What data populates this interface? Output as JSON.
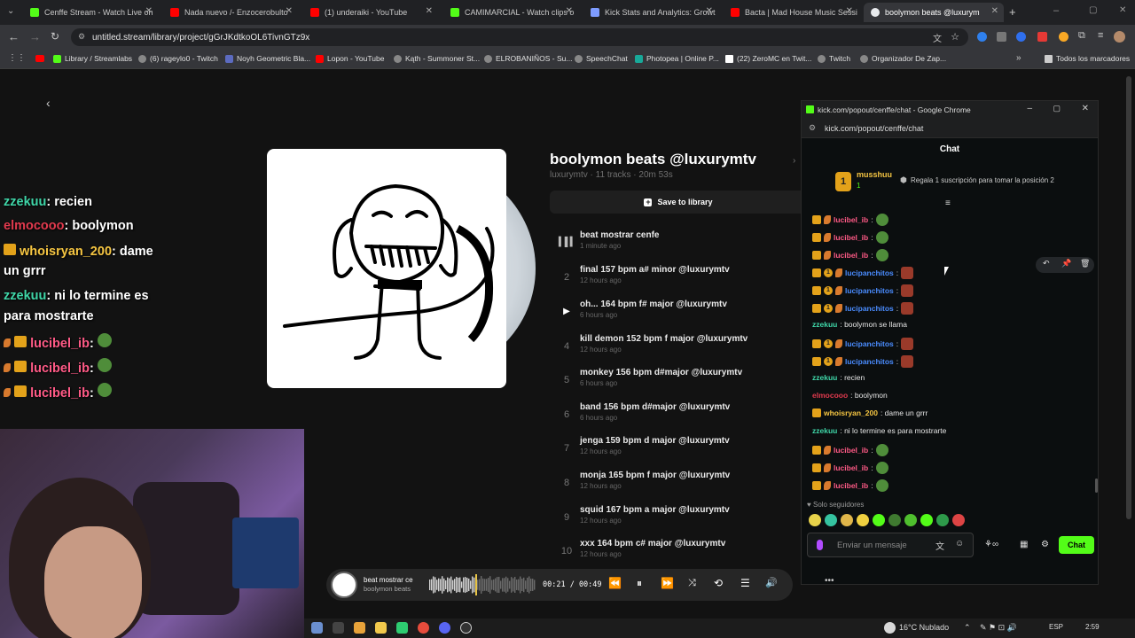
{
  "browser": {
    "tabs": [
      {
        "label": "Cenffe Stream - Watch Live on",
        "color": "#53fc18"
      },
      {
        "label": "Nada nuevo /- Enzocerobulto",
        "color": "#ff0000"
      },
      {
        "label": "(1) underaiki - YouTube",
        "color": "#ff0000"
      },
      {
        "label": "CAMIMARCIAL - Watch clips o",
        "color": "#53fc18"
      },
      {
        "label": "Kick Stats and Analytics: Growt",
        "color": "#7e9cff"
      },
      {
        "label": "Bacta | Mad House Music Sessi",
        "color": "#ff0000"
      },
      {
        "label": "boolymon beats @luxurym",
        "color": "#e8eaed"
      }
    ],
    "url": "untitled.stream/library/project/gGrJKdtkoOL6TivnGTz9x",
    "bookmarks": [
      "Library / Streamlabs",
      "(6) rageylo0 - Twitch",
      "Noyh Geometric Bla...",
      "Lopon - YouTube",
      "Kąth - Summoner St...",
      "ELROBANIÑOS - Su...",
      "SpeechChat",
      "Photopea | Online P...",
      "(22) ZeroMC en Twit...",
      "Twitch",
      "Organizador De Zap..."
    ],
    "bookmarks_all": "Todos los marcadores"
  },
  "project": {
    "title": "boolymon beats @luxurymtv",
    "meta": "luxurymtv · 11 tracks · 20m 53s",
    "save_label": "Save to library",
    "tracks": [
      {
        "num": "",
        "name": "beat mostrar cenfe",
        "date": "1 minute ago"
      },
      {
        "num": "2",
        "name": "final 157 bpm a# minor @luxurymtv",
        "date": "12 hours ago"
      },
      {
        "num": "",
        "name": "oh... 164 bpm f# major @luxurymtv",
        "date": "6 hours ago"
      },
      {
        "num": "4",
        "name": "kill demon 152 bpm f major @luxurymtv",
        "date": "12 hours ago"
      },
      {
        "num": "5",
        "name": "monkey 156 bpm d#major @luxurymtv",
        "date": "6 hours ago"
      },
      {
        "num": "6",
        "name": "band 156 bpm d#major @luxurymtv",
        "date": "6 hours ago"
      },
      {
        "num": "7",
        "name": "jenga 159 bpm d major @luxurymtv",
        "date": "12 hours ago"
      },
      {
        "num": "8",
        "name": "monja 165 bpm f major @luxurymtv",
        "date": "12 hours ago"
      },
      {
        "num": "9",
        "name": "squid 167 bpm a major @luxurymtv",
        "date": "12 hours ago"
      },
      {
        "num": "10",
        "name": "xxx 164 bpm c# major @luxurymtv",
        "date": "12 hours ago"
      }
    ]
  },
  "overlay_chat": {
    "m1_user": "zzekuu",
    "m1_text": ": recien",
    "m2_user": "elmocooo",
    "m2_text": ": boolymon",
    "m3_user": "whoisryan_200",
    "m3_text": ": dame",
    "m3_cont": "un grrr",
    "m4_user": "zzekuu",
    "m4_text": ": ni lo termine es",
    "m4_cont": "para mostrarte",
    "m5_user": "lucibel_ib",
    "m5_text": ":"
  },
  "player": {
    "track": "beat mostrar ce",
    "artist": "boolymon beats",
    "time": "00:21 / 00:49",
    "progress": 0.43
  },
  "kick": {
    "window_title": "kick.com/popout/cenffe/chat - Google Chrome",
    "url": "kick.com/popout/cenffe/chat",
    "header": "Chat",
    "top_user": "musshuu",
    "top_count": "1",
    "gift_text": "Regala 1 suscripción para tomar la posición 2",
    "messages": [
      {
        "user": "lucibel_ib",
        "text": ":",
        "color": "u-pink",
        "badges": "crown,pepper"
      },
      {
        "user": "lucibel_ib",
        "text": ":",
        "color": "u-pink",
        "badges": "crown,pepper"
      },
      {
        "user": "lucibel_ib",
        "text": ":",
        "color": "u-pink",
        "badges": "crown,pepper"
      },
      {
        "user": "lucipanchitos",
        "text": ":",
        "color": "u-blue",
        "badges": "crown,one,pepper"
      },
      {
        "user": "lucipanchitos",
        "text": ":",
        "color": "u-blue",
        "badges": "crown,one,pepper"
      },
      {
        "user": "lucipanchitos",
        "text": ":",
        "color": "u-blue",
        "badges": "crown,one,pepper"
      },
      {
        "user": "zzekuu",
        "text": ": boolymon se llama",
        "color": "u-teal",
        "badges": ""
      },
      {
        "user": "lucipanchitos",
        "text": ":",
        "color": "u-blue",
        "badges": "crown,one,pepper"
      },
      {
        "user": "lucipanchitos",
        "text": ":",
        "color": "u-blue",
        "badges": "crown,one,pepper"
      },
      {
        "user": "zzekuu",
        "text": ": recien",
        "color": "u-teal",
        "badges": ""
      },
      {
        "user": "elmocooo",
        "text": ": boolymon",
        "color": "u-red",
        "badges": ""
      },
      {
        "user": "whoisryan_200",
        "text": ": dame un grrr",
        "color": "u-gold",
        "badges": "crown"
      },
      {
        "user": "zzekuu",
        "text": ": ni lo termine es para mostrarte",
        "color": "u-teal",
        "badges": ""
      },
      {
        "user": "lucibel_ib",
        "text": ":",
        "color": "u-pink",
        "badges": "crown,pepper"
      },
      {
        "user": "lucibel_ib",
        "text": ":",
        "color": "u-pink",
        "badges": "crown,pepper"
      },
      {
        "user": "lucibel_ib",
        "text": ":",
        "color": "u-pink",
        "badges": "crown,pepper"
      }
    ],
    "followers_only": "Solo seguidores",
    "input_placeholder": "Enviar un mensaje",
    "send_label": "Chat"
  },
  "taskbar": {
    "weather": "16°C  Nublado",
    "lang": "ESP",
    "time": "2:59"
  }
}
